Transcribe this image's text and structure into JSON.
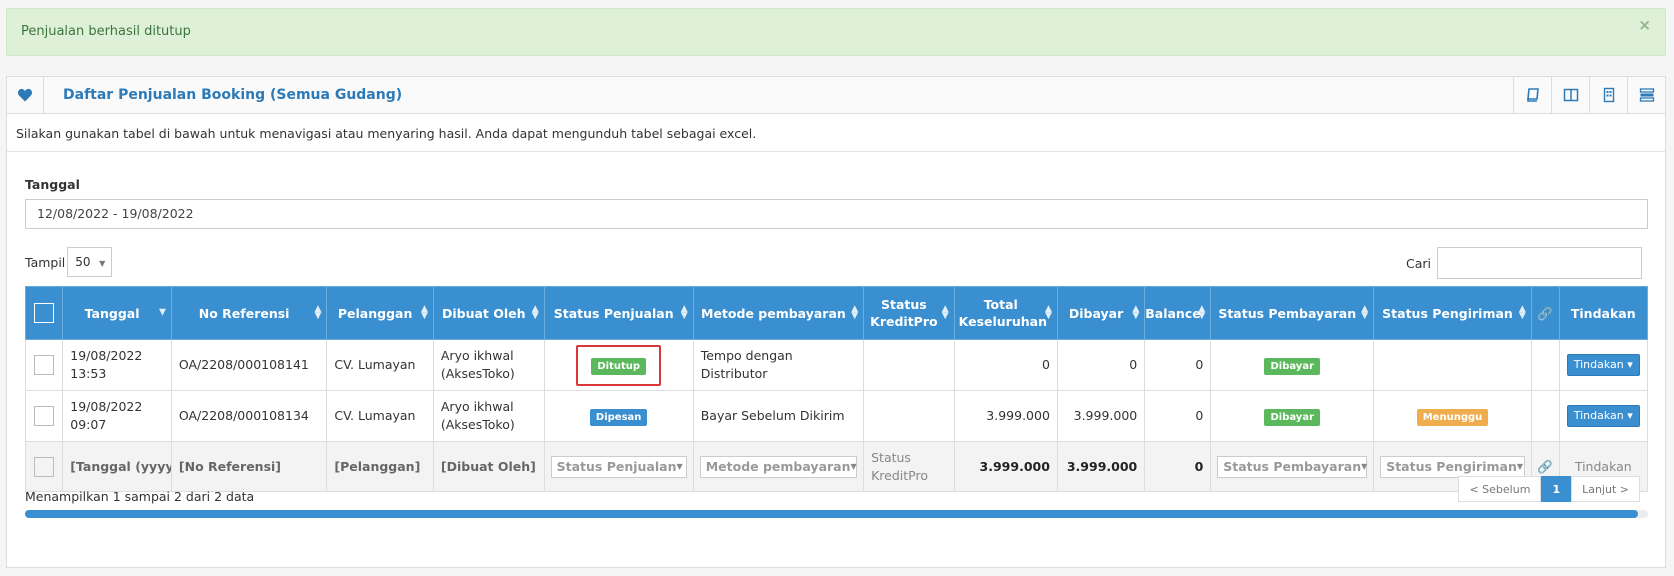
{
  "alert": {
    "message": "Penjualan berhasil ditutup",
    "close": "×"
  },
  "box": {
    "title": "Daftar Penjualan Booking (Semua Gudang)",
    "subtext": "Silakan gunakan tabel di bawah untuk menavigasi atau menyaring hasil. Anda dapat mengunduh tabel sebagai excel.",
    "header_icons": [
      "book-icon",
      "columns-icon",
      "building-icon",
      "list-settings-icon"
    ]
  },
  "filters": {
    "date_label": "Tanggal",
    "date_value": "12/08/2022 - 19/08/2022",
    "show_label": "Tampil",
    "show_value": "50",
    "search_label": "Cari"
  },
  "table": {
    "headers": {
      "date": "Tanggal",
      "ref": "No Referensi",
      "customer": "Pelanggan",
      "created_by": "Dibuat Oleh",
      "sale_status": "Status Penjualan",
      "payment_method": "Metode pembayaran",
      "kreditpro": "Status KreditPro",
      "total": "Total Keseluruhan",
      "paid": "Dibayar",
      "balance": "Balance",
      "payment_status": "Status Pembayaran",
      "delivery_status": "Status Pengiriman",
      "action": "Tindakan"
    },
    "rows": [
      {
        "date": "19/08/2022",
        "time": "13:53",
        "ref": "OA/2208/000108141",
        "customer": "CV. Lumayan",
        "created_by_1": "Aryo ikhwal",
        "created_by_2": "(AksesToko)",
        "sale_status": "Ditutup",
        "payment_method_1": "Tempo dengan",
        "payment_method_2": "Distributor",
        "kreditpro": "",
        "total": "0",
        "paid": "0",
        "balance": "0",
        "payment_status": "Dibayar",
        "delivery_status": "",
        "action": "Tindakan"
      },
      {
        "date": "19/08/2022",
        "time": "09:07",
        "ref": "OA/2208/000108134",
        "customer": "CV. Lumayan",
        "created_by_1": "Aryo ikhwal",
        "created_by_2": "(AksesToko)",
        "sale_status": "Dipesan",
        "payment_method_1": "Bayar Sebelum Dikirim",
        "payment_method_2": "",
        "kreditpro": "",
        "total": "3.999.000",
        "paid": "3.999.000",
        "balance": "0",
        "payment_status": "Dibayar",
        "delivery_status": "Menunggu",
        "action": "Tindakan"
      }
    ],
    "filter_row": {
      "date": "[Tanggal (yyyy-",
      "ref": "[No Referensi]",
      "customer": "[Pelanggan]",
      "created_by": "[Dibuat Oleh]",
      "sale_status": "Status Penjualan",
      "payment_method": "Metode pembayaran",
      "kreditpro_1": "Status",
      "kreditpro_2": "KreditPro",
      "total": "3.999.000",
      "paid": "3.999.000",
      "balance": "0",
      "payment_status": "Status Pembayaran",
      "delivery_status": "Status Pengiriman",
      "action": "Tindakan"
    }
  },
  "footer": {
    "info": "Menampilkan 1 sampai 2 dari 2 data",
    "prev": "< Sebelum",
    "page": "1",
    "next": "Lanjut >"
  },
  "colors": {
    "primary": "#3a8fd1",
    "success": "#5cb85c",
    "warning": "#f0ad4e",
    "alert_bg": "#dff0d8",
    "highlight": "#d9383a"
  }
}
